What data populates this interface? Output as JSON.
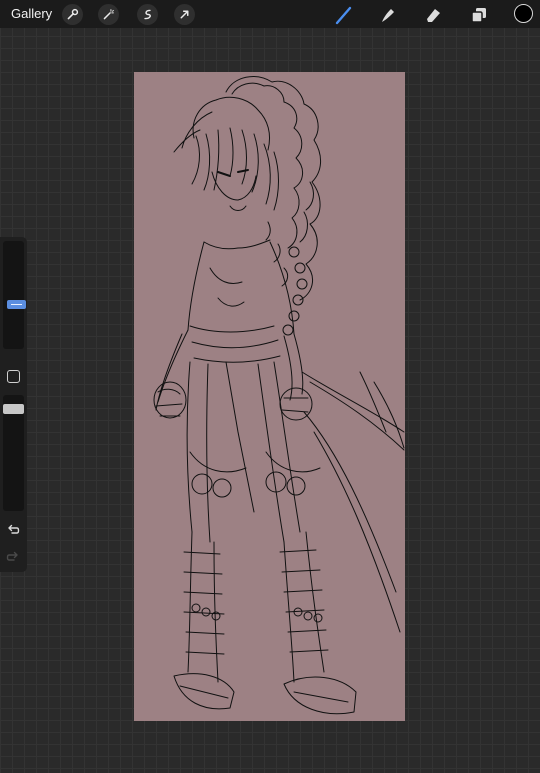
{
  "topbar": {
    "gallery_label": "Gallery",
    "left_tools": [
      "wrench-icon",
      "magic-wand-icon",
      "selection-icon",
      "transform-icon"
    ],
    "right_tools": [
      "brush-icon",
      "smudge-icon",
      "eraser-icon",
      "layers-icon"
    ],
    "active_tool": "brush",
    "active_color": "#000000"
  },
  "canvas": {
    "background_color": "#9d8184",
    "content": "sketch-drawing"
  },
  "sidebar": {
    "brush_size_level": 0.18,
    "opacity_level": 1.0,
    "undo": "undo-icon",
    "redo": "redo-icon"
  },
  "colors": {
    "accent": "#4a8ef0",
    "workspace": "#2a2a2a",
    "toolbar": "#1b1b1b"
  }
}
